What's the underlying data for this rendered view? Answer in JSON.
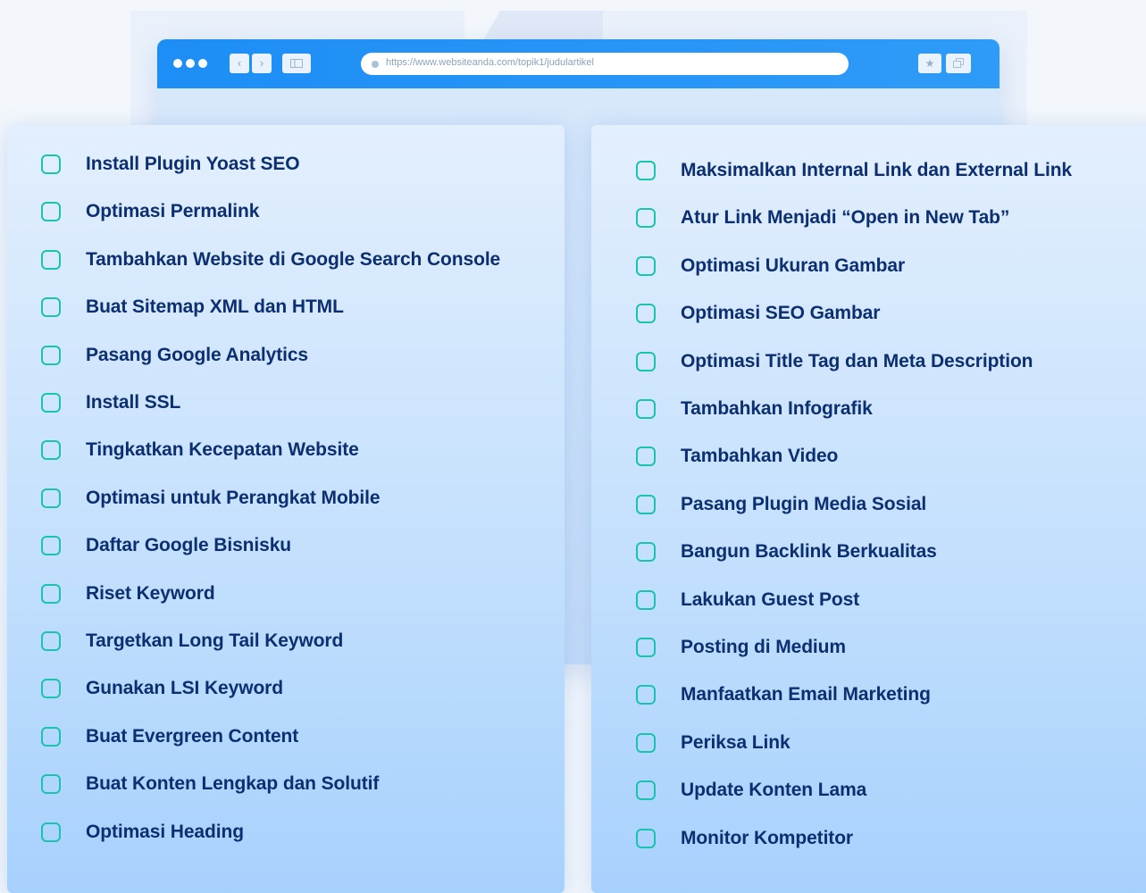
{
  "browser": {
    "url": "https://www.websiteanda.com/topik1/judulartikel",
    "icons": [
      "window-dots-icon",
      "back-icon",
      "forward-icon",
      "sidebar-icon",
      "lock-dot-icon",
      "star-icon",
      "window-icon"
    ]
  },
  "colors": {
    "toolbar": "#1d8ef5",
    "checkbox": "#19c3ae",
    "text": "#0c2f72"
  },
  "left_list": [
    "Install Plugin Yoast SEO",
    "Optimasi Permalink",
    "Tambahkan Website di Google Search Console",
    "Buat Sitemap XML dan HTML",
    "Pasang Google Analytics",
    "Install SSL",
    "Tingkatkan Kecepatan Website",
    "Optimasi untuk Perangkat Mobile",
    "Daftar Google Bisnisku",
    "Riset Keyword",
    "Targetkan Long Tail Keyword",
    "Gunakan LSI Keyword",
    "Buat Evergreen Content",
    "Buat Konten Lengkap dan Solutif",
    "Optimasi Heading"
  ],
  "right_list": [
    "Maksimalkan Internal Link dan External Link",
    "Atur Link Menjadi “Open in New Tab”",
    "Optimasi Ukuran Gambar",
    "Optimasi SEO Gambar",
    "Optimasi Title Tag dan Meta Description",
    "Tambahkan Infografik",
    "Tambahkan Video",
    "Pasang Plugin Media Sosial",
    "Bangun Backlink Berkualitas",
    "Lakukan Guest Post",
    "Posting di Medium",
    "Manfaatkan Email Marketing",
    "Periksa Link",
    "Update Konten Lama",
    "Monitor Kompetitor"
  ]
}
